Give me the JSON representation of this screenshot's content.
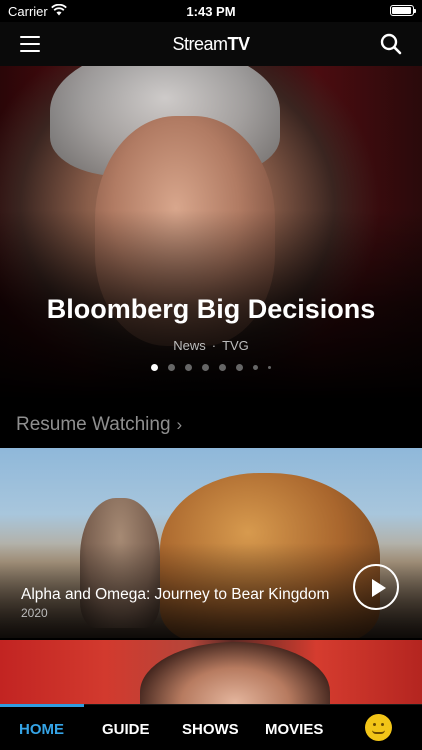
{
  "status_bar": {
    "carrier": "Carrier",
    "time": "1:43 PM"
  },
  "nav": {
    "brand_bold": "Stream",
    "brand_accent": "TV",
    "menu_icon": "hamburger-menu-icon",
    "search_icon": "search-icon"
  },
  "hero": {
    "title": "Bloomberg Big Decisions",
    "genre": "News",
    "separator": "·",
    "network": "TVG",
    "page_count": 8,
    "current_page": 1
  },
  "resume": {
    "header": "Resume Watching",
    "items": [
      {
        "title": "Alpha and Omega: Journey to Bear Kingdom",
        "year": "2020"
      }
    ]
  },
  "tabs": [
    {
      "label": "HOME",
      "active": true
    },
    {
      "label": "GUIDE",
      "active": false
    },
    {
      "label": "SHOWS",
      "active": false
    },
    {
      "label": "MOVIES",
      "active": false
    }
  ],
  "colors": {
    "accent": "#35a4e6",
    "avatar": "#f2c518"
  }
}
